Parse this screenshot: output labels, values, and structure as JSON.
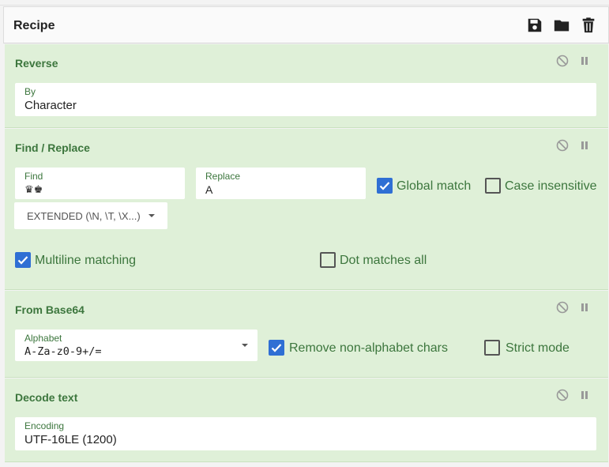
{
  "header": {
    "title": "Recipe",
    "icons": [
      "save-icon",
      "folder-icon",
      "trash-icon"
    ]
  },
  "ops": {
    "reverse": {
      "title": "Reverse",
      "by_label": "By",
      "by_value": "Character"
    },
    "find_replace": {
      "title": "Find / Replace",
      "find_label": "Find",
      "find_value": "♛♚",
      "replace_label": "Replace",
      "replace_value": "A",
      "global_match_label": "Global match",
      "global_match": true,
      "case_insensitive_label": "Case insensitive",
      "case_insensitive": false,
      "mode_value": "EXTENDED (\\N, \\T, \\X...)",
      "multiline_label": "Multiline matching",
      "multiline": true,
      "dot_all_label": "Dot matches all",
      "dot_all": false
    },
    "from_base64": {
      "title": "From Base64",
      "alphabet_label": "Alphabet",
      "alphabet_value": "A-Za-z0-9+/=",
      "remove_nonalpha_label": "Remove non-alphabet chars",
      "remove_nonalpha": true,
      "strict_label": "Strict mode",
      "strict": false
    },
    "decode_text": {
      "title": "Decode text",
      "encoding_label": "Encoding",
      "encoding_value": "UTF-16LE (1200)"
    }
  },
  "colors": {
    "op_bg": "#dff0d8",
    "op_text": "#3c763d",
    "checkbox_on": "#2f6fd4"
  }
}
